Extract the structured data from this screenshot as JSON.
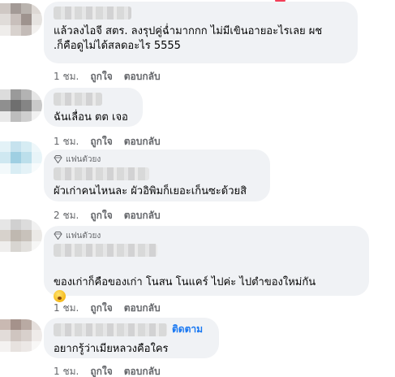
{
  "comments": [
    {
      "text": "แล้วลงไอจี สตร. ลงรุปคู่ฉ่ำมากกก ไม่มีเขินอายอะไรเลย ผช\n.ก็คือดูไม่ได้สลดอะไร 5555",
      "time": "1 ชม.",
      "like": "ถูกใจ",
      "reply": "ตอบกลับ"
    },
    {
      "text": "ฉันเลื่อน ตต เจอ",
      "time": "1 ชม.",
      "like": "ถูกใจ",
      "reply": "ตอบกลับ"
    },
    {
      "badge": "แฟนตัวยง",
      "text": "ผัวเก่าคนไหนละ ผัวอิพิมก็เยอะเก็นซะด้วยสิ",
      "time": "2 ชม.",
      "like": "ถูกใจ",
      "reply": "ตอบกลับ"
    },
    {
      "badge": "แฟนตัวยง",
      "text": "ของเก่าก็คือของเก่า โนสน โนแคร์ ไปค่ะ ไปตำของใหม่กัน",
      "time": "1 ชม.",
      "like": "ถูกใจ",
      "reply": "ตอบกลับ"
    },
    {
      "follow": "ติดตาม",
      "text": "อยากรู้ว่าเมียหลวงคือใคร",
      "time": "1 ชม.",
      "like": "ถูกใจ",
      "reply": "ตอบกลับ"
    }
  ],
  "icons": {
    "badge": "diamond-icon",
    "emoji": "grinning-face-emoji",
    "reaction": "reaction-icon"
  },
  "colors": {
    "bubble": "#f0f2f5",
    "secondary_text": "#65676b",
    "link": "#1877f2"
  }
}
